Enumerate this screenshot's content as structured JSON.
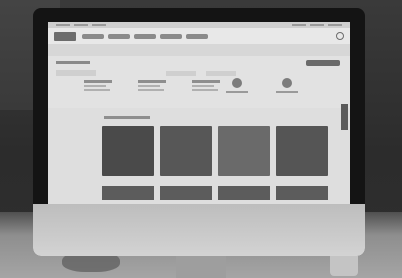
{
  "scene": "photo-of-desktop-monitor"
}
